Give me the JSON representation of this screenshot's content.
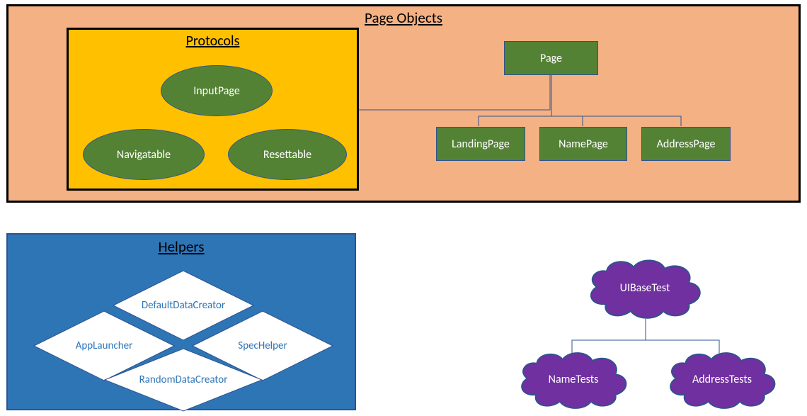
{
  "pageObjects": {
    "title": "Page Objects",
    "protocols": {
      "title": "Protocols",
      "items": {
        "inputPage": "InputPage",
        "navigatable": "Navigatable",
        "resettable": "Resettable"
      }
    },
    "pages": {
      "root": "Page",
      "children": {
        "landing": "LandingPage",
        "name": "NamePage",
        "address": "AddressPage"
      }
    }
  },
  "helpers": {
    "title": "Helpers",
    "items": {
      "defaultDataCreator": "DefaultDataCreator",
      "appLauncher": "AppLauncher",
      "specHelper": "SpecHelper",
      "randomDataCreator": "RandomDataCreator"
    }
  },
  "tests": {
    "root": "UIBaseTest",
    "children": {
      "nameTests": "NameTests",
      "addressTests": "AddressTests"
    }
  }
}
